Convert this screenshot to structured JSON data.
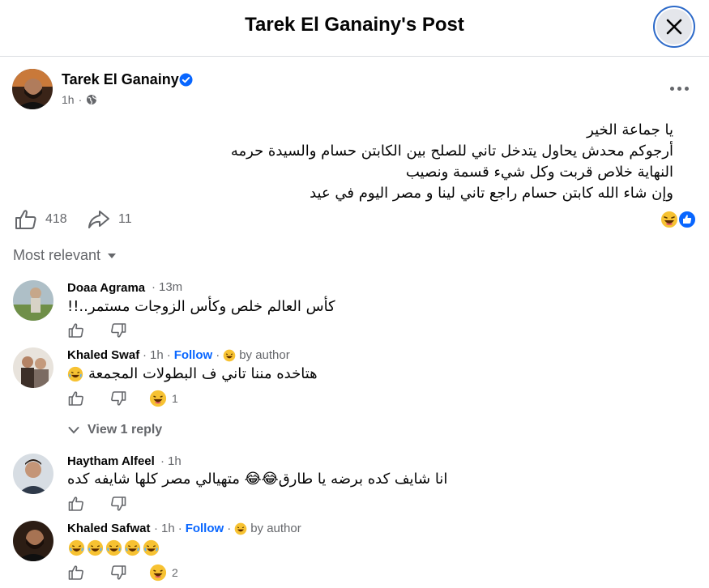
{
  "header": {
    "title": "Tarek El Ganainy's Post"
  },
  "post": {
    "author": "Tarek El Ganainy",
    "time": "1h",
    "lines": [
      "يا جماعة الخير",
      "أرجوكم محدش يحاول يتدخل تاني للصلح بين الكابتن حسام والسيدة حرمه",
      "النهاية خلاص قربت وكل شيء قسمة ونصيب",
      "وإن شاء الله كابتن حسام راجع تاني لينا و مصر اليوم في عيد"
    ],
    "likes_count": "418",
    "shares_count": "11"
  },
  "sort_label": "Most relevant",
  "comments": [
    {
      "name": "Doaa Agrama",
      "time": "13m",
      "text": "كأس العالم خلص وكأس الزوجات مستمر..!!"
    },
    {
      "name": "Khaled Swaf",
      "time": "1h",
      "follow": "Follow",
      "by_author": "by author",
      "text": "هتاخده مننا تاني ف البطولات المجمعة",
      "reaction_count": "1"
    },
    {
      "name": "Haytham Alfeel",
      "time": "1h",
      "text": "انا شايف كده برضه يا طارق😂😂 متهيالي مصر كلها شايفه كده"
    },
    {
      "name": "Khaled Safwat",
      "time": "1h",
      "follow": "Follow",
      "by_author": "by author",
      "reaction_count": "2"
    }
  ],
  "view_reply": "View 1 reply",
  "colors": {
    "accent": "#0866ff",
    "secondary_text": "#65676b",
    "verified": "#0866ff"
  }
}
